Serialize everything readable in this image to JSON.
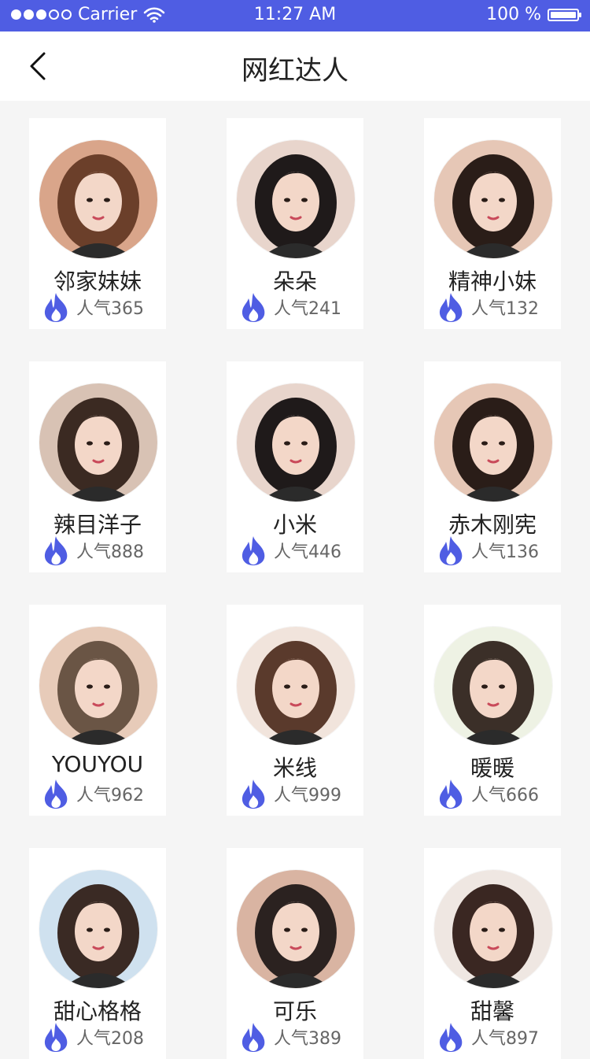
{
  "status_bar": {
    "carrier": "Carrier",
    "time": "11:27 AM",
    "battery": "100 %",
    "signal_bars_filled": 3,
    "signal_bars_total": 5,
    "battery_level": 1.0
  },
  "nav": {
    "title": "网红达人",
    "back_icon": "chevron-left-icon"
  },
  "colors": {
    "accent": "#4f5de3",
    "fire": "#4f5de3"
  },
  "influencers": [
    {
      "name": "邻家妹妹",
      "popularity": "人气365",
      "avatar_colors": [
        "#d9a58a",
        "#6b3f2a"
      ]
    },
    {
      "name": "朵朵",
      "popularity": "人气241",
      "avatar_colors": [
        "#e8d5cc",
        "#1f1a1a"
      ]
    },
    {
      "name": "精神小妹",
      "popularity": "人气132",
      "avatar_colors": [
        "#e6c7b6",
        "#2a1d18"
      ]
    },
    {
      "name": "辣目洋子",
      "popularity": "人气888",
      "avatar_colors": [
        "#d8c2b4",
        "#3b2a22"
      ]
    },
    {
      "name": "小米",
      "popularity": "人气446",
      "avatar_colors": [
        "#e8d5cc",
        "#1f1a1a"
      ]
    },
    {
      "name": "赤木刚宪",
      "popularity": "人气136",
      "avatar_colors": [
        "#e6c7b6",
        "#2a1d18"
      ]
    },
    {
      "name": "YOUYOU",
      "popularity": "人气962",
      "avatar_colors": [
        "#e7cbb9",
        "#6a5545"
      ]
    },
    {
      "name": "米线",
      "popularity": "人气999",
      "avatar_colors": [
        "#f1e4dc",
        "#5a3a2c"
      ]
    },
    {
      "name": "暖暖",
      "popularity": "人气666",
      "avatar_colors": [
        "#eef2e4",
        "#3b2f28"
      ]
    },
    {
      "name": "甜心格格",
      "popularity": "人气208",
      "avatar_colors": [
        "#cfe1ef",
        "#3a2a24"
      ]
    },
    {
      "name": "可乐",
      "popularity": "人气389",
      "avatar_colors": [
        "#d9b4a2",
        "#2b2220"
      ]
    },
    {
      "name": "甜馨",
      "popularity": "人气897",
      "avatar_colors": [
        "#efe7e2",
        "#3a2722"
      ]
    }
  ]
}
